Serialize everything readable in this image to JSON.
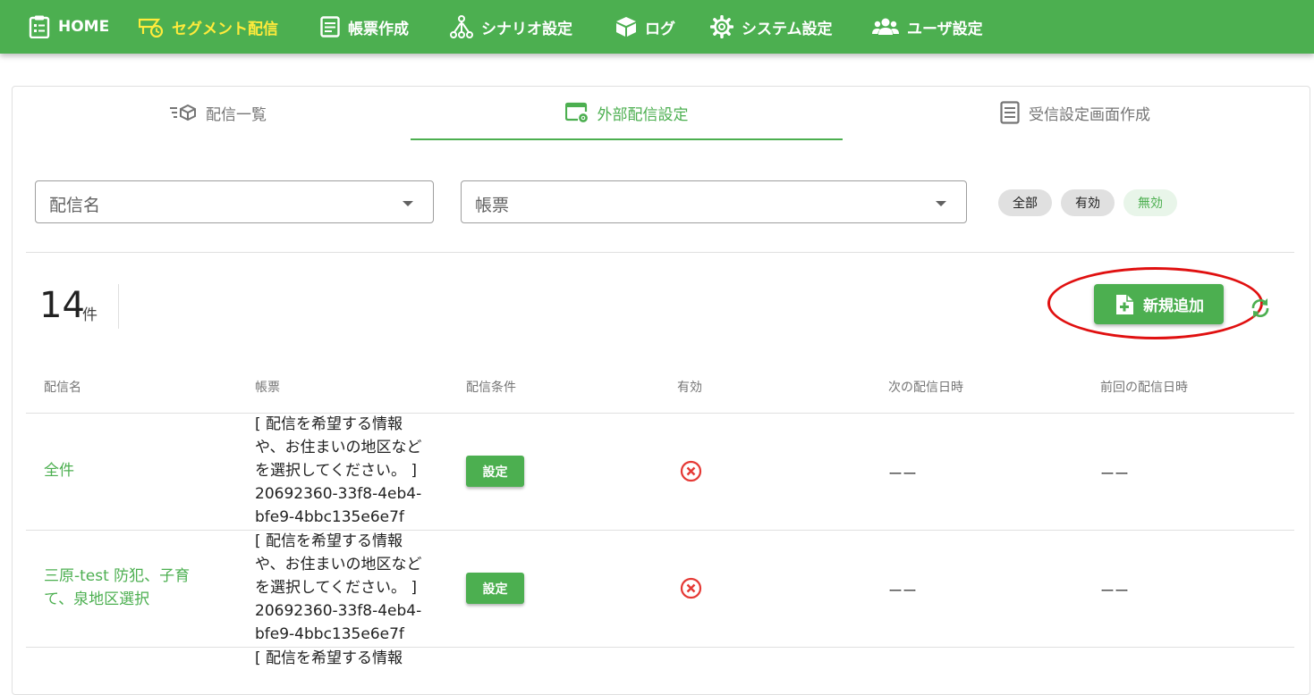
{
  "nav": {
    "items": [
      {
        "label": "HOME",
        "icon": "clipboard-list-icon"
      },
      {
        "label": "セグメント配信",
        "icon": "segment-delivery-icon",
        "active": true
      },
      {
        "label": "帳票作成",
        "icon": "form-icon"
      },
      {
        "label": "シナリオ設定",
        "icon": "scenario-tree-icon"
      },
      {
        "label": "ログ",
        "icon": "box-icon"
      },
      {
        "label": "システム設定",
        "icon": "gear-icon"
      },
      {
        "label": "ユーザ設定",
        "icon": "users-icon"
      }
    ]
  },
  "tabs": [
    {
      "label": "配信一覧",
      "icon": "delivery-list-icon"
    },
    {
      "label": "外部配信設定",
      "icon": "external-settings-icon",
      "active": true
    },
    {
      "label": "受信設定画面作成",
      "icon": "document-icon"
    }
  ],
  "filters": {
    "delivery_name_placeholder": "配信名",
    "form_placeholder": "帳票",
    "chips": [
      "全部",
      "有効",
      "無効"
    ],
    "active_chip": "無効"
  },
  "count": {
    "value": "14",
    "unit": "件"
  },
  "add_button_label": "新規追加",
  "table": {
    "headers": [
      "配信名",
      "帳票",
      "配信条件",
      "有効",
      "次の配信日時",
      "前回の配信日時"
    ],
    "rows": [
      {
        "name_lines": [
          "全件"
        ],
        "form_lines": [
          "[ 配信を希望する情報",
          "や、お住まいの地区など",
          "を選択してください。 ]",
          "20692360-33f8-4eb4-",
          "bfe9-4bbc135e6e7f"
        ],
        "condition_button": "設定",
        "enabled": false,
        "next": "ーー",
        "prev": "ーー"
      },
      {
        "name_lines": [
          "三原-test 防犯、子育",
          "て、泉地区選択"
        ],
        "form_lines": [
          "[ 配信を希望する情報",
          "や、お住まいの地区など",
          "を選択してください。 ]",
          "20692360-33f8-4eb4-",
          "bfe9-4bbc135e6e7f"
        ],
        "condition_button": "設定",
        "enabled": false,
        "next": "ーー",
        "prev": "ーー"
      },
      {
        "name_lines": [],
        "form_lines": [
          "[ 配信を希望する情報"
        ]
      }
    ]
  },
  "colors": {
    "primary": "#4caf50",
    "nav_active": "#ffeb3b",
    "disabled_icon": "#e53935",
    "highlight": "#e01010"
  }
}
